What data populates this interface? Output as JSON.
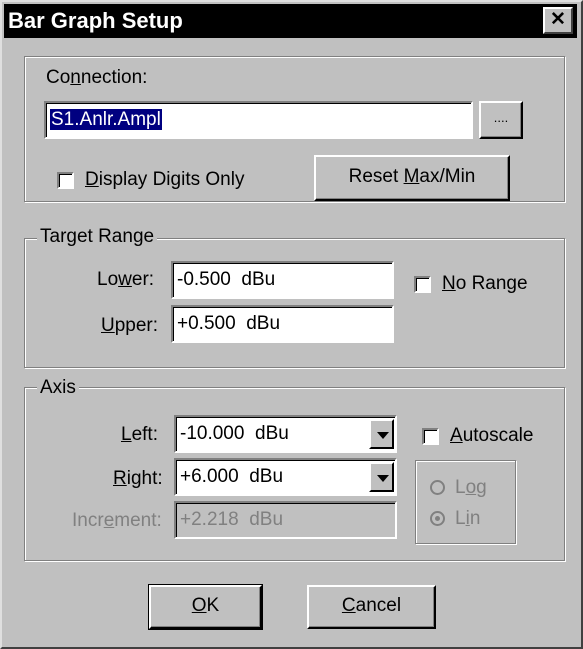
{
  "window": {
    "title": "Bar Graph Setup",
    "close_glyph": "✕"
  },
  "connection": {
    "group_label_pre": "Co",
    "group_label_u": "n",
    "group_label_post": "nection:",
    "value": "S1.Anlr.Ampl",
    "browse_label": "....",
    "display_digits_pre": "",
    "display_digits_u": "D",
    "display_digits_post": "isplay Digits Only",
    "display_digits_checked": false,
    "reset_pre": "Reset ",
    "reset_u": "M",
    "reset_post": "ax/Min"
  },
  "target_range": {
    "legend": "Target Range",
    "lower_pre": "Lo",
    "lower_u": "w",
    "lower_post": "er:",
    "lower_value": "-0.500  dBu",
    "upper_pre": "",
    "upper_u": "U",
    "upper_post": "pper:",
    "upper_value": "+0.500  dBu",
    "no_range_pre": "",
    "no_range_u": "N",
    "no_range_post": "o Range",
    "no_range_checked": false
  },
  "axis": {
    "legend": "Axis",
    "left_pre": "",
    "left_u": "L",
    "left_post": "eft:",
    "left_value": "-10.000  dBu",
    "right_pre": "",
    "right_u": "R",
    "right_post": "ight:",
    "right_value": "+6.000  dBu",
    "increment_pre": "Incr",
    "increment_u": "e",
    "increment_post": "ment:",
    "increment_value": "+2.218  dBu",
    "autoscale_pre": "",
    "autoscale_u": "A",
    "autoscale_post": "utoscale",
    "autoscale_checked": false,
    "log_pre": "L",
    "log_u": "o",
    "log_post": "g",
    "lin_pre": "L",
    "lin_u": "i",
    "lin_post": "n",
    "selected_scale": "Lin"
  },
  "buttons": {
    "ok_pre": "",
    "ok_u": "O",
    "ok_post": "K",
    "cancel_pre": "",
    "cancel_u": "C",
    "cancel_post": "ancel"
  }
}
